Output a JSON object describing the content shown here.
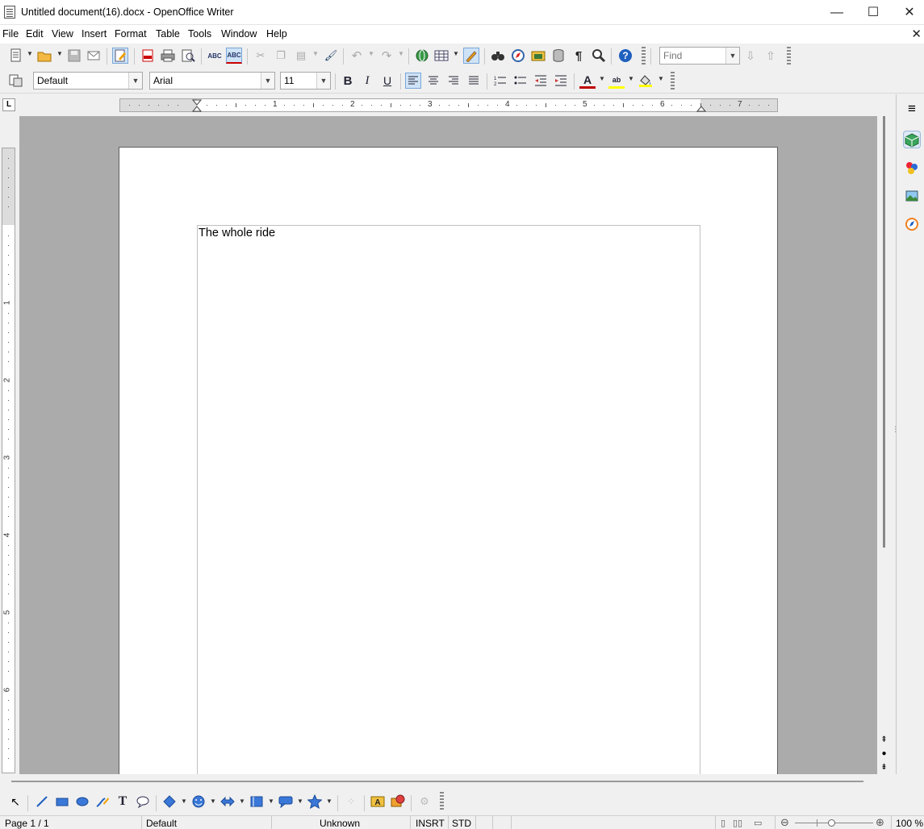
{
  "window": {
    "title": "Untitled document(16).docx - OpenOffice Writer",
    "controls": {
      "minimize": "—",
      "maximize": "☐",
      "close": "✕"
    }
  },
  "menubar": {
    "items": [
      "File",
      "Edit",
      "View",
      "Insert",
      "Format",
      "Table",
      "Tools",
      "Window",
      "Help"
    ],
    "close_doc": "✕"
  },
  "toolbar_standard": {
    "find": {
      "placeholder": "Find",
      "value": ""
    }
  },
  "toolbar_formatting": {
    "paragraph_style": "Default",
    "font_name": "Arial",
    "font_size": "11",
    "bold": "B",
    "italic": "I",
    "underline": "U"
  },
  "ruler": {
    "tab_type": "L",
    "h_numbers": [
      "1",
      "2",
      "3",
      "4",
      "5",
      "6",
      "7"
    ],
    "v_numbers": [
      "1",
      "2",
      "3",
      "4",
      "5",
      "6"
    ]
  },
  "document": {
    "text": "The whole ride"
  },
  "statusbar": {
    "page": "Page 1 / 1",
    "style": "Default",
    "language": "Unknown",
    "insert_mode": "INSRT",
    "selection_mode": "STD",
    "zoom": "100 %"
  },
  "colors": {
    "accent": "#cfe3f7",
    "doc_background": "#ababab",
    "font_color_bar": "#c00000",
    "highlight_bar": "#ffff00"
  },
  "icons": {
    "standard": [
      "new-icon",
      "open-icon",
      "save-icon",
      "email-icon",
      "edit-mode-icon",
      "export-pdf-icon",
      "print-icon",
      "print-preview-icon",
      "spellcheck-icon",
      "autospell-icon",
      "cut-icon",
      "copy-icon",
      "paste-icon",
      "clone-format-icon",
      "undo-icon",
      "redo-icon",
      "hyperlink-icon",
      "table-icon",
      "show-draw-icon",
      "find-replace-icon",
      "navigator-icon",
      "gallery-icon",
      "data-sources-icon",
      "formatting-marks-icon",
      "zoom-icon",
      "help-icon"
    ],
    "sidebar": [
      "sidebar-menu-icon",
      "properties-icon",
      "styles-icon",
      "gallery-icon",
      "navigator-icon"
    ]
  }
}
